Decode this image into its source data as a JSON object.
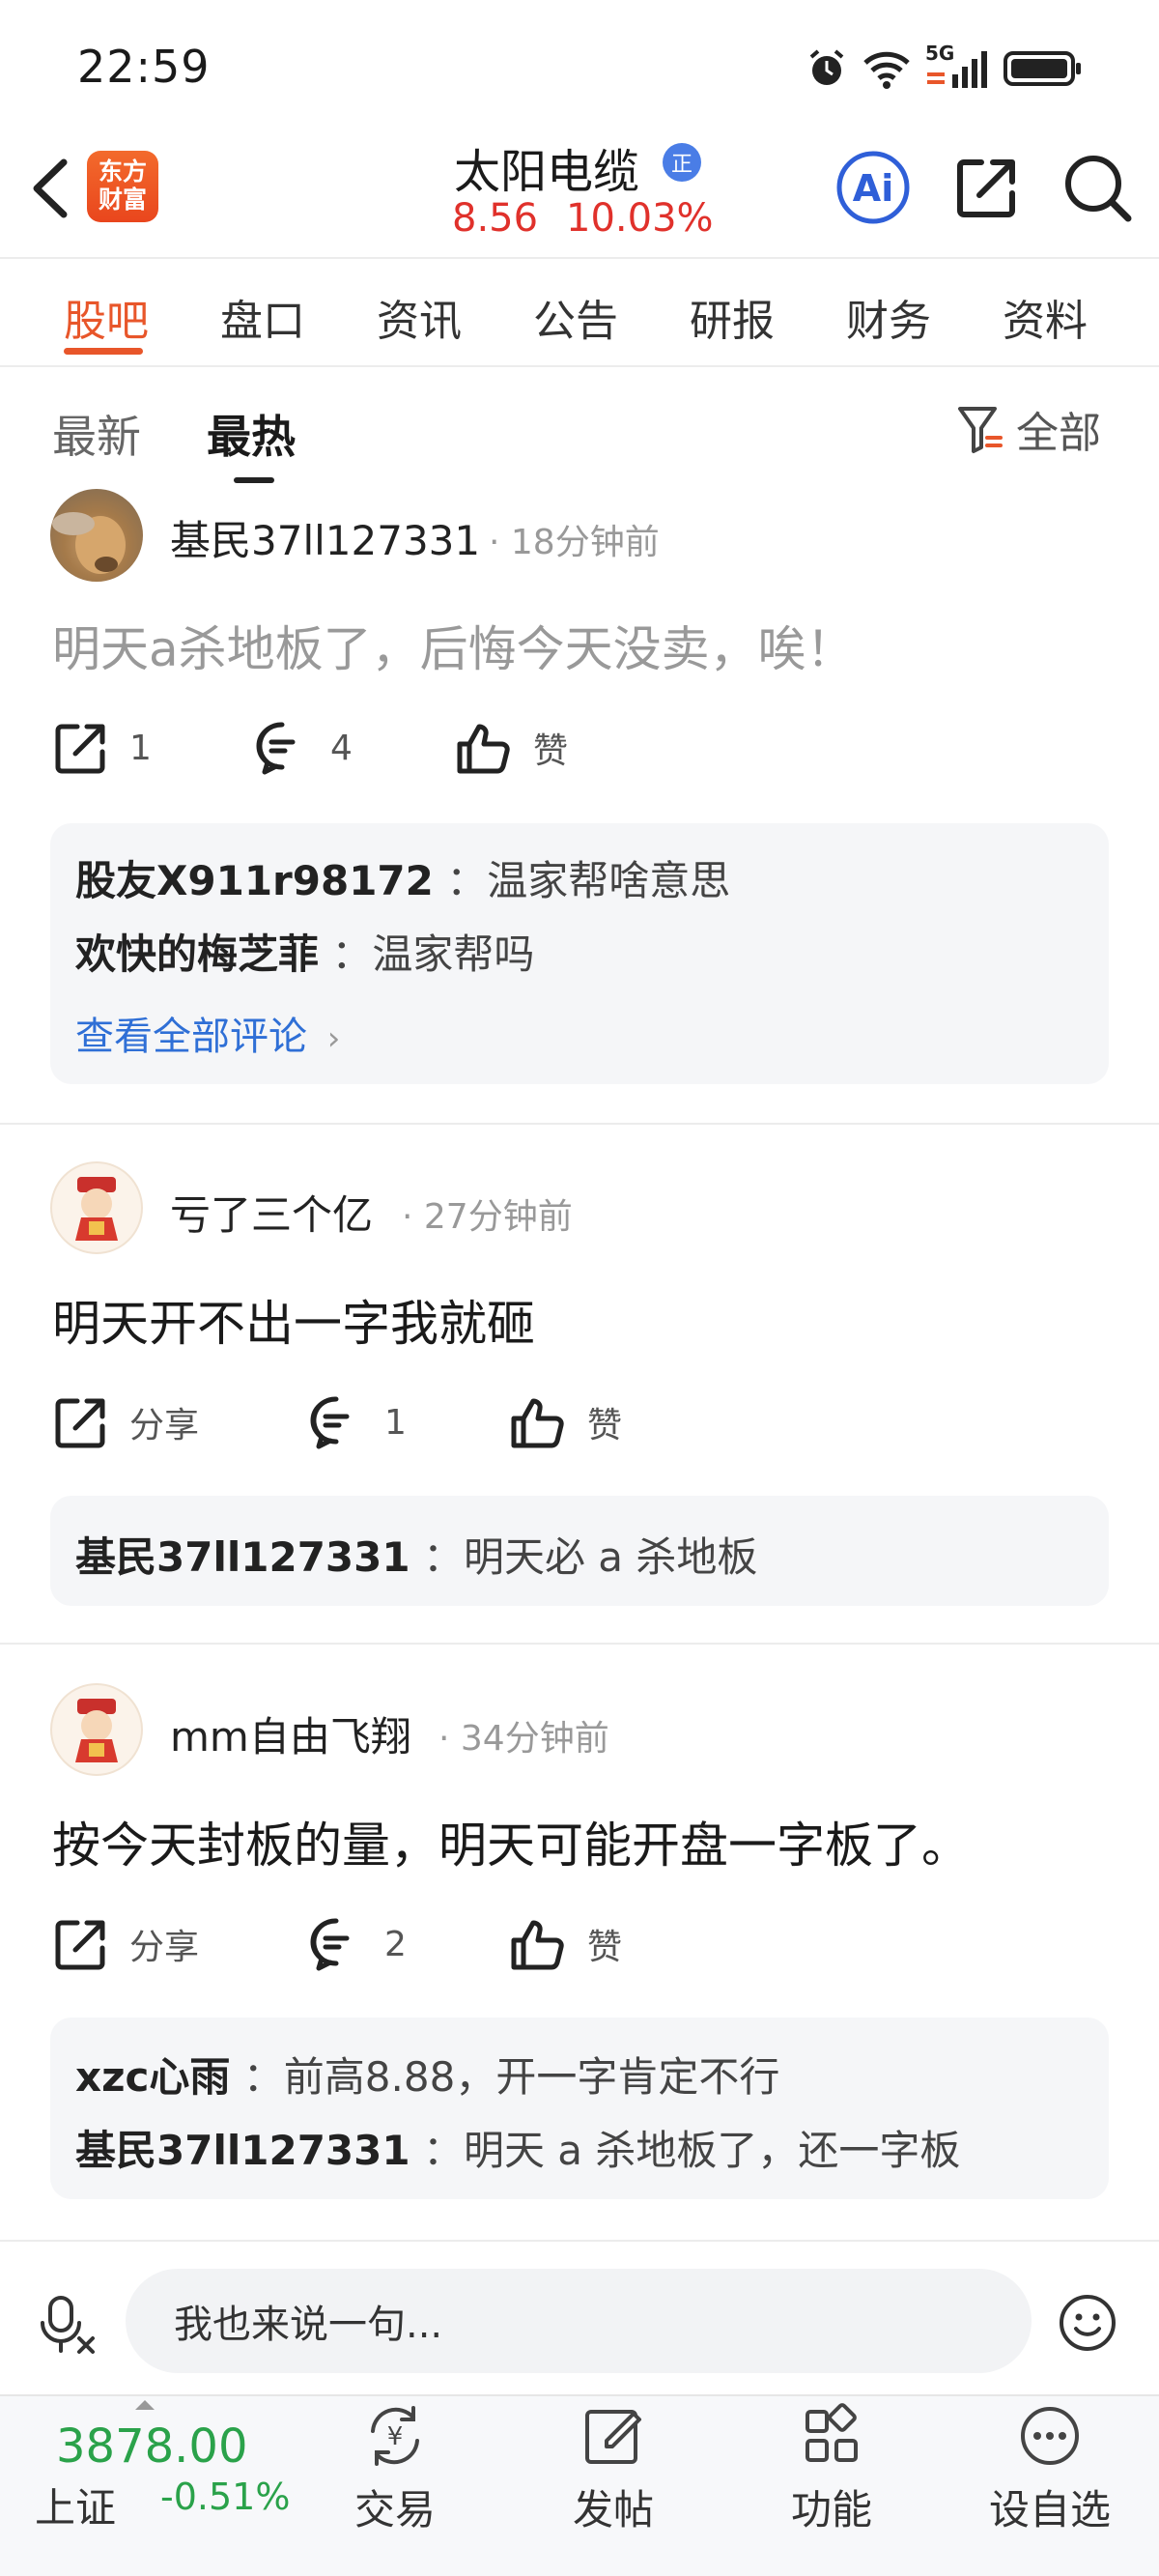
{
  "status": {
    "time": "22:59",
    "network": "5G"
  },
  "header": {
    "logo_line1": "东方",
    "logo_line2": "财富",
    "stock_name": "太阳电缆",
    "badge": "正",
    "price": "8.56",
    "change_pct": "10.03%",
    "ai_label": "Ai"
  },
  "tabs": [
    {
      "label": "股吧",
      "active": true
    },
    {
      "label": "盘口"
    },
    {
      "label": "资讯"
    },
    {
      "label": "公告"
    },
    {
      "label": "研报"
    },
    {
      "label": "财务"
    },
    {
      "label": "资料"
    }
  ],
  "subtabs": {
    "latest": "最新",
    "hottest": "最热",
    "filter": "全部"
  },
  "posts": [
    {
      "user": "基民37ll127331",
      "time": "· 18分钟前",
      "text": "明天a杀地板了，后悔今天没卖，唉！",
      "share": "1",
      "comments": "4",
      "like": "赞",
      "replies": [
        {
          "user": "股友X911r98172",
          "text": "：温家帮啥意思"
        },
        {
          "user": "欢快的梅芝菲",
          "text": "：温家帮吗"
        }
      ],
      "more": "查看全部评论"
    },
    {
      "user": "亏了三个亿",
      "time": "· 27分钟前",
      "text": "明天开不出一字我就砸",
      "share": "分享",
      "comments": "1",
      "like": "赞",
      "replies": [
        {
          "user": "基民37ll127331",
          "text": "：明天必 a 杀地板"
        }
      ]
    },
    {
      "user": "mm自由飞翔",
      "time": "· 34分钟前",
      "text": "按今天封板的量，明天可能开盘一字板了。",
      "share": "分享",
      "comments": "2",
      "like": "赞",
      "replies": [
        {
          "user": "xzc心雨",
          "text": "：前高8.88，开一字肯定不行"
        },
        {
          "user": "基民37ll127331",
          "text": "：明天 a 杀地板了，还一字板"
        }
      ]
    }
  ],
  "input": {
    "placeholder": "我也来说一句..."
  },
  "bottom_bar": {
    "index_value": "3878.00",
    "index_name": "上证",
    "index_change": "-0.51%",
    "items": [
      {
        "label": "交易",
        "icon": "trade-icon"
      },
      {
        "label": "发帖",
        "icon": "compose-icon"
      },
      {
        "label": "功能",
        "icon": "grid-icon"
      },
      {
        "label": "设自选",
        "icon": "more-icon"
      }
    ]
  },
  "colors": {
    "accent": "#e8562a",
    "up": "#e0312b",
    "down": "#2aa24a",
    "link": "#2f6fd6"
  }
}
